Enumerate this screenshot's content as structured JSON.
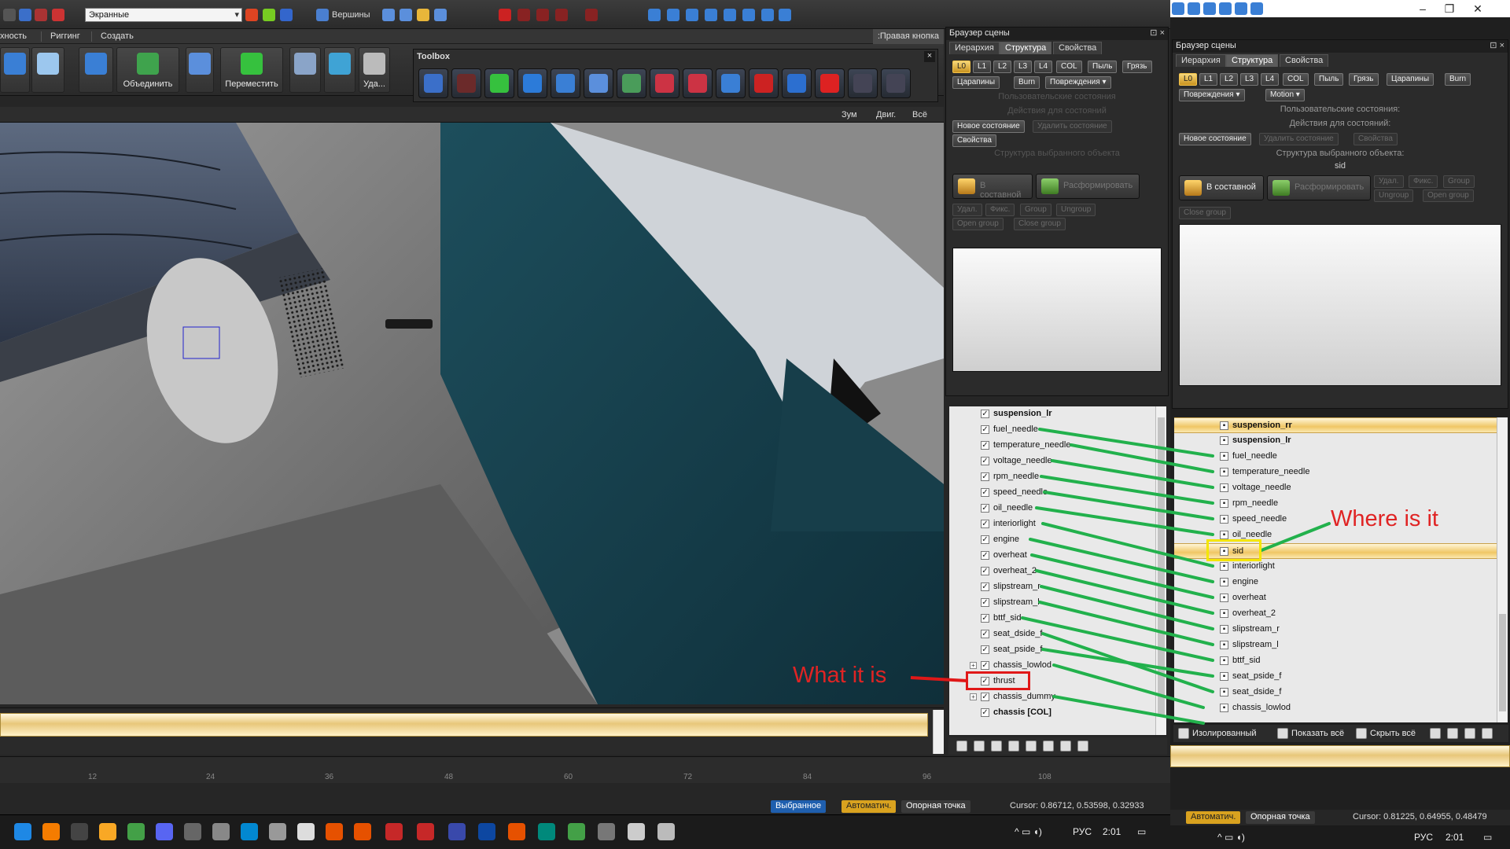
{
  "left": {
    "qat": {
      "view_combo": "Экранные",
      "vertices_label": "Вершины"
    },
    "menu": [
      "хность",
      "Риггинг",
      "Создать"
    ],
    "right_mouse_label": ":Правая кнопка",
    "ribbon": [
      {
        "label": ""
      },
      {
        "label": ""
      },
      {
        "label": ""
      },
      {
        "label": "Объединить"
      },
      {
        "label": ""
      },
      {
        "label": "Переместить"
      },
      {
        "label": ""
      },
      {
        "label": ""
      },
      {
        "label": "Уда..."
      }
    ],
    "toolbox_title": "Toolbox",
    "viewport_bar": {
      "zoom": "Зум",
      "move": "Двиг.",
      "all": "Всё"
    },
    "ruler_ticks": [
      "12",
      "24",
      "36",
      "48",
      "60",
      "72",
      "84",
      "96",
      "108"
    ],
    "status": {
      "selected": "Выбранное",
      "auto": "Автоматич.",
      "pivot": "Опорная точка",
      "cursor": "Cursor: 0.86712, 0.53598, 0.32933"
    },
    "tray": {
      "lang": "РУС",
      "time": "2:01"
    }
  },
  "scene_browser_left": {
    "title": "Браузер сцены",
    "tabs": [
      "Иерархия",
      "Структура",
      "Свойства"
    ],
    "lod_chips": [
      "L0",
      "L1",
      "L2",
      "L3",
      "L4",
      "COL",
      "Пыль",
      "Грязь"
    ],
    "chips2": [
      "Царапины",
      "Burn",
      "Повреждения"
    ],
    "sec_user_states": "Пользовательские состояния",
    "sec_actions": "Действия для состояний",
    "btn_new_state": "Новое состояние",
    "btn_delete_state": "Удалить состояние",
    "btn_props": "Свойства",
    "sec_structure": "Структура выбранного объекта",
    "btn_compound": "В составной",
    "btn_disband": "Расформировать",
    "small_btns": [
      "Удал.",
      "Фикс.",
      "Group",
      "Ungroup",
      "Open group",
      "Close group"
    ],
    "rows": [
      {
        "name": "suspension_lr",
        "bold": true
      },
      {
        "name": "fuel_needle"
      },
      {
        "name": "temperature_needle"
      },
      {
        "name": "voltage_needle"
      },
      {
        "name": "rpm_needle"
      },
      {
        "name": "speed_needle"
      },
      {
        "name": "oil_needle"
      },
      {
        "name": "interiorlight"
      },
      {
        "name": "engine"
      },
      {
        "name": "overheat"
      },
      {
        "name": "overheat_2"
      },
      {
        "name": "slipstream_r"
      },
      {
        "name": "slipstream_l"
      },
      {
        "name": "bttf_sid"
      },
      {
        "name": "seat_dside_f"
      },
      {
        "name": "seat_pside_f"
      },
      {
        "name": "chassis_lowlod",
        "expander": true
      },
      {
        "name": "thrust"
      },
      {
        "name": "chassis_dummy",
        "expander": true
      },
      {
        "name": "chassis [COL]",
        "bold": true
      }
    ]
  },
  "scene_browser_right": {
    "title": "Браузер сцены",
    "tabs": [
      "Иерархия",
      "Структура",
      "Свойства"
    ],
    "lod_chips": [
      "L0",
      "L1",
      "L2",
      "L3",
      "L4",
      "COL",
      "Пыль",
      "Грязь",
      "Царапины",
      "Burn"
    ],
    "chips2": [
      "Повреждения",
      "Motion"
    ],
    "sec_user_states": "Пользовательские состояния:",
    "sec_actions": "Действия для состояний:",
    "btn_new_state": "Новое состояние",
    "btn_delete_state": "Удалить состояние",
    "btn_props": "Свойства",
    "sec_structure": "Структура выбранного объекта:",
    "selected_obj": "sid",
    "btn_compound": "В составной",
    "btn_disband": "Расформировать",
    "small_btns": [
      "Удал.",
      "Фикс.",
      "Group",
      "Ungroup",
      "Open group",
      "Close group"
    ],
    "rows": [
      {
        "name": "suspension_rr",
        "bold": true,
        "hl": true
      },
      {
        "name": "suspension_lr",
        "bold": true
      },
      {
        "name": "fuel_needle"
      },
      {
        "name": "temperature_needle"
      },
      {
        "name": "voltage_needle"
      },
      {
        "name": "rpm_needle"
      },
      {
        "name": "speed_needle"
      },
      {
        "name": "oil_needle"
      },
      {
        "name": "sid",
        "hl": true
      },
      {
        "name": "interiorlight"
      },
      {
        "name": "engine"
      },
      {
        "name": "overheat"
      },
      {
        "name": "overheat_2"
      },
      {
        "name": "slipstream_r"
      },
      {
        "name": "slipstream_l"
      },
      {
        "name": "bttf_sid"
      },
      {
        "name": "seat_pside_f"
      },
      {
        "name": "seat_dside_f"
      },
      {
        "name": "chassis_lowlod"
      }
    ],
    "bottom": {
      "isolated": "Изолированный",
      "show_all": "Показать всё",
      "hide_all": "Скрыть всё"
    },
    "status": {
      "auto": "Автоматич.",
      "pivot": "Опорная точка",
      "cursor": "Cursor: 0.81225, 0.64955, 0.48479"
    },
    "tray": {
      "lang": "РУС",
      "time": "2:01"
    }
  },
  "annotations": {
    "what": "What it is",
    "where": "Where is it"
  },
  "colors": {
    "accent_gold": "#f0c765",
    "annotation_red": "#e02424",
    "connector_green": "#22b14c",
    "highlight_yellow": "#f4e600"
  }
}
